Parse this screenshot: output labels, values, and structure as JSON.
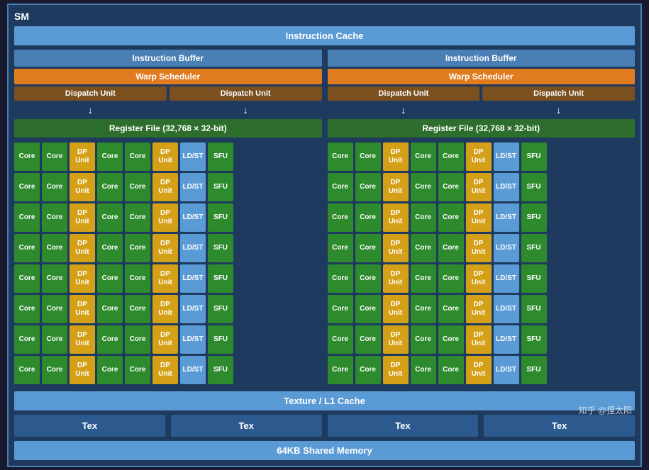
{
  "title": "SM",
  "instruction_cache": "Instruction Cache",
  "left": {
    "instruction_buffer": "Instruction Buffer",
    "warp_scheduler": "Warp Scheduler",
    "dispatch_unit_1": "Dispatch Unit",
    "dispatch_unit_2": "Dispatch Unit",
    "register_file": "Register File (32,768 × 32-bit)"
  },
  "right": {
    "instruction_buffer": "Instruction Buffer",
    "warp_scheduler": "Warp Scheduler",
    "dispatch_unit_1": "Dispatch Unit",
    "dispatch_unit_2": "Dispatch Unit",
    "register_file": "Register File (32,768 × 32-bit)"
  },
  "rows": [
    [
      "Core",
      "Core",
      "DP\nUnit",
      "Core",
      "Core",
      "DP\nUnit",
      "LD/ST",
      "SFU"
    ],
    [
      "Core",
      "Core",
      "DP\nUnit",
      "Core",
      "Core",
      "DP\nUnit",
      "LD/ST",
      "SFU"
    ],
    [
      "Core",
      "Core",
      "DP\nUnit",
      "Core",
      "Core",
      "DP\nUnit",
      "LD/ST",
      "SFU"
    ],
    [
      "Core",
      "Core",
      "DP\nUnit",
      "Core",
      "Core",
      "DP\nUnit",
      "LD/ST",
      "SFU"
    ],
    [
      "Core",
      "Core",
      "DP\nUnit",
      "Core",
      "Core",
      "DP\nUnit",
      "LD/ST",
      "SFU"
    ],
    [
      "Core",
      "Core",
      "DP\nUnit",
      "Core",
      "Core",
      "DP\nUnit",
      "LD/ST",
      "SFU"
    ],
    [
      "Core",
      "Core",
      "DP\nUnit",
      "Core",
      "Core",
      "DP\nUnit",
      "LD/ST",
      "SFU"
    ],
    [
      "Core",
      "Core",
      "DP\nUnit",
      "Core",
      "Core",
      "DP\nUnit",
      "LD/ST",
      "SFU"
    ]
  ],
  "texture_cache": "Texture / L1 Cache",
  "tex_units": [
    "Tex",
    "Tex",
    "Tex",
    "Tex"
  ],
  "shared_memory": "64KB Shared Memory",
  "watermark": "知乎 @捏太阳",
  "colors": {
    "core": "#2d8a2d",
    "dp": "#d4a017",
    "ldst": "#5b9bd5",
    "sfu": "#2d8a2d"
  }
}
